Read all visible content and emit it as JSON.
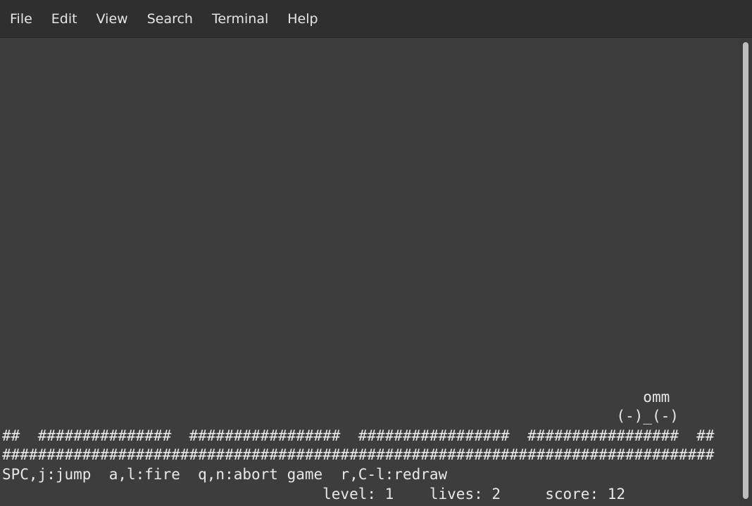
{
  "menubar": {
    "items": [
      "File",
      "Edit",
      "View",
      "Search",
      "Terminal",
      "Help"
    ]
  },
  "terminal": {
    "lines": [
      "                                                                        omm",
      "                                                                     (-)_(-)",
      "##  ###############  #################  #################  #################  ##",
      "################################################################################",
      "SPC,j:jump  a,l:fire  q,n:abort game  r,C-l:redraw",
      "                                    level: 1    lives: 2     score: 12"
    ]
  }
}
